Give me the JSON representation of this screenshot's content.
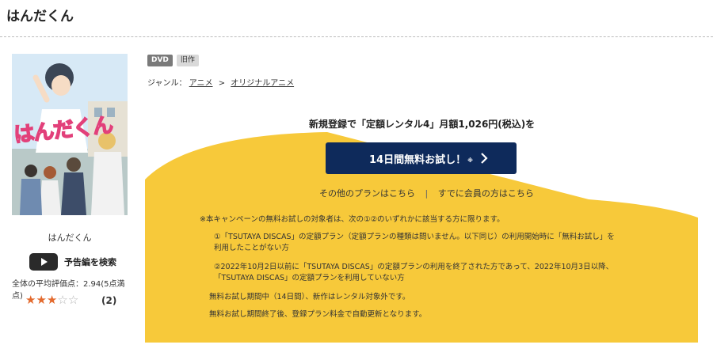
{
  "page": {
    "title": "はんだくん"
  },
  "item": {
    "poster_logo": "はんだくん",
    "title": "はんだくん",
    "trailer_label": "予告編を検索",
    "rating_text": "全体の平均評価点：2.94(5点満点)",
    "rating_stars": 3,
    "rating_max": 5,
    "review_count": "(2)"
  },
  "tags": [
    "DVD",
    "旧作"
  ],
  "genre": {
    "label": "ジャンル：",
    "items": [
      "アニメ",
      "オリジナルアニメ"
    ],
    "separator": ">"
  },
  "campaign": {
    "heading": "新規登録で「定額レンタル4」月額1,026円(税込)を",
    "button_label": "14日間無料お試し！",
    "button_note": "※",
    "link_other_plans": "その他のプランはこちら",
    "link_separator": "|",
    "link_members": "すでに会員の方はこちら",
    "notes": [
      "※本キャンペーンの無料お試しの対象者は、次の①②のいずれかに該当する方に限ります。",
      "①「TSUTAYA DISCAS」の定額プラン（定額プランの種類は問いません。以下同じ）の利用開始時に「無料お試し」を",
      "利用したことがない方",
      "②2022年10月2日以前に「TSUTAYA DISCAS」の定額プランの利用を終了された方であって、2022年10月3日以降、",
      "「TSUTAYA DISCAS」の定額プランを利用していない方",
      "無料お試し期間中（14日間）、新作はレンタル対象外です。",
      "無料お試し期間終了後、登録プラン料金で自動更新となります。"
    ]
  },
  "colors": {
    "accent_yellow": "#f7c93a",
    "button_navy": "#0e2a5b",
    "star_orange": "#e36a2e"
  }
}
